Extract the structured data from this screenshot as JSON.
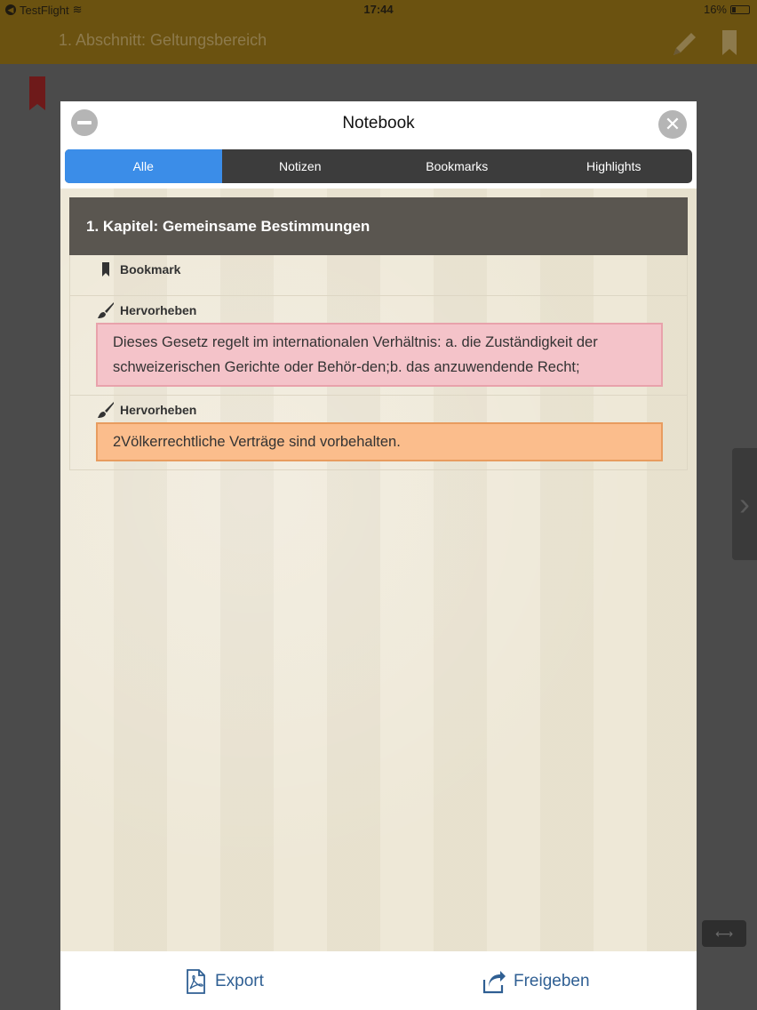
{
  "status_bar": {
    "carrier": "TestFlight",
    "time": "17:44",
    "battery": "16%"
  },
  "nav": {
    "title": "1. Abschnitt: Geltungsbereich"
  },
  "modal": {
    "title": "Notebook",
    "tabs": [
      {
        "label": "Alle",
        "active": true
      },
      {
        "label": "Notizen",
        "active": false
      },
      {
        "label": "Bookmarks",
        "active": false
      },
      {
        "label": "Highlights",
        "active": false
      }
    ],
    "chapter": "1. Kapitel: Gemeinsame Bestimmungen",
    "entries": [
      {
        "type": "Bookmark",
        "icon": "bookmark-icon"
      },
      {
        "type": "Hervorheben",
        "icon": "brush-icon",
        "text": "Dieses Gesetz regelt im internationalen Verhältnis: a. die Zuständigkeit der schweizerischen Gerichte oder Behör-den;b. das anzuwendende Recht;",
        "color": "#f4c3c9"
      },
      {
        "type": "Hervorheben",
        "icon": "brush-icon",
        "text": "2Völkerrechtliche Verträge sind vorbehalten.",
        "color": "#fbbd8c"
      }
    ],
    "footer": {
      "export_label": "Export",
      "share_label": "Freigeben"
    }
  },
  "colors": {
    "accent": "#3b8de8",
    "link": "#2f5f93",
    "nav_bg": "#6b5210"
  }
}
